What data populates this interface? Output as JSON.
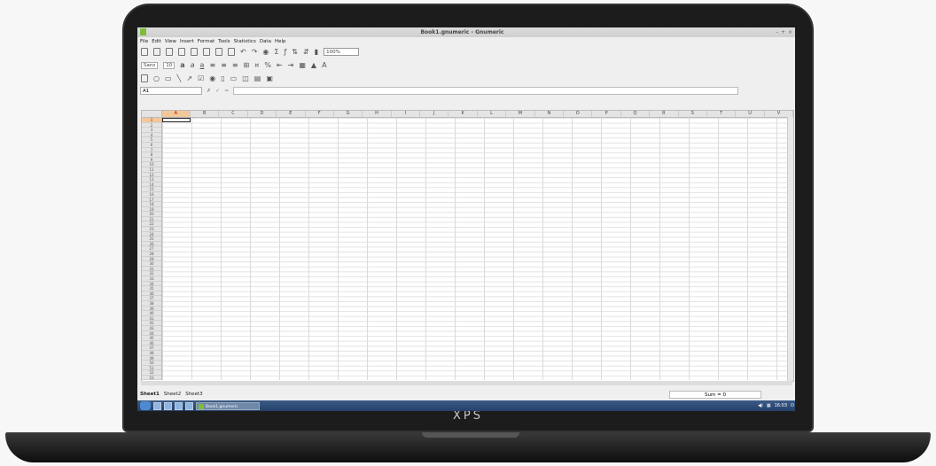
{
  "window": {
    "title": "Book1.gnumeric - Gnumeric",
    "controls": [
      "–",
      "+",
      "×"
    ]
  },
  "menu": [
    "File",
    "Edit",
    "View",
    "Insert",
    "Format",
    "Tools",
    "Statistics",
    "Data",
    "Help"
  ],
  "toolbar": {
    "zoom": "100%",
    "font": "Sans",
    "font_size": "10",
    "bold": "a",
    "italic": "a",
    "underline": "a"
  },
  "formula_bar": {
    "cell_ref": "A1",
    "cancel_icon": "✗",
    "accept_icon": "✓",
    "equals_icon": "="
  },
  "columns": [
    "A",
    "B",
    "C",
    "D",
    "E",
    "F",
    "G",
    "H",
    "I",
    "J",
    "K",
    "L",
    "M",
    "N",
    "O",
    "P",
    "Q",
    "R",
    "S",
    "T",
    "U",
    "V"
  ],
  "rows": [
    "1",
    "2",
    "3",
    "4",
    "5",
    "6",
    "7",
    "8",
    "9",
    "10",
    "11",
    "12",
    "13",
    "14",
    "15",
    "16",
    "17",
    "18",
    "19",
    "20",
    "21",
    "22",
    "23",
    "24",
    "25",
    "26",
    "27",
    "28",
    "29",
    "30",
    "31",
    "32",
    "33",
    "34",
    "35",
    "36",
    "37",
    "38",
    "39",
    "40",
    "41",
    "42",
    "43",
    "44",
    "45",
    "46",
    "47",
    "48",
    "49",
    "50",
    "51",
    "52",
    "53"
  ],
  "sheets": [
    "Sheet1",
    "Sheet2",
    "Sheet3"
  ],
  "status": {
    "sum": "Sum = 0"
  },
  "taskbar": {
    "task_label": "Book1.gnumeric",
    "clock": "16:03"
  },
  "laptop": {
    "brand": "XPS"
  },
  "colors": {
    "selection": "#f2c89a",
    "taskbar": "#2f4d78",
    "bezel": "#1c1c1c"
  }
}
